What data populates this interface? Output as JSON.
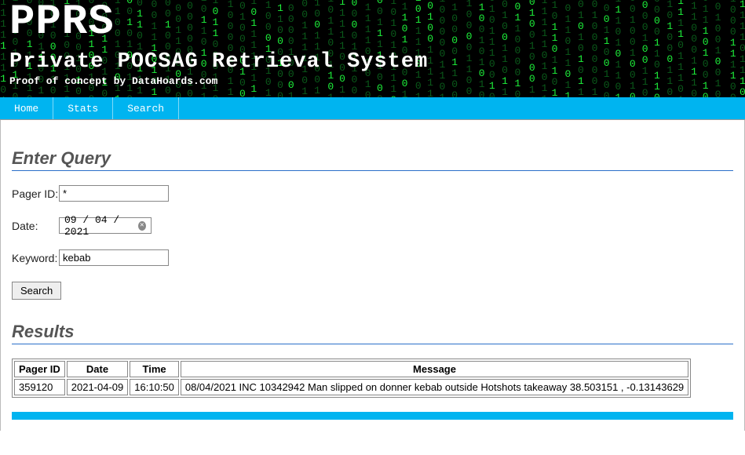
{
  "banner": {
    "title": "PPRS",
    "subtitle": "Private POCSAG Retrieval System",
    "tagline": "Proof of concept by DataHoards.com"
  },
  "nav": {
    "home": "Home",
    "stats": "Stats",
    "search": "Search"
  },
  "query": {
    "heading": "Enter Query",
    "pager_label": "Pager ID:",
    "pager_value": "*",
    "date_label": "Date:",
    "date_value": "09 / 04 / 2021",
    "keyword_label": "Keyword:",
    "keyword_value": "kebab",
    "search_btn": "Search"
  },
  "results": {
    "heading": "Results",
    "columns": {
      "pager": "Pager ID",
      "date": "Date",
      "time": "Time",
      "message": "Message"
    },
    "rows": [
      {
        "pager": "359120",
        "date": "2021-04-09",
        "time": "16:10:50",
        "message": "08/04/2021 INC 10342942 Man slipped on donner kebab outside Hotshots takeaway 38.503151 , -0.13143629"
      }
    ]
  }
}
